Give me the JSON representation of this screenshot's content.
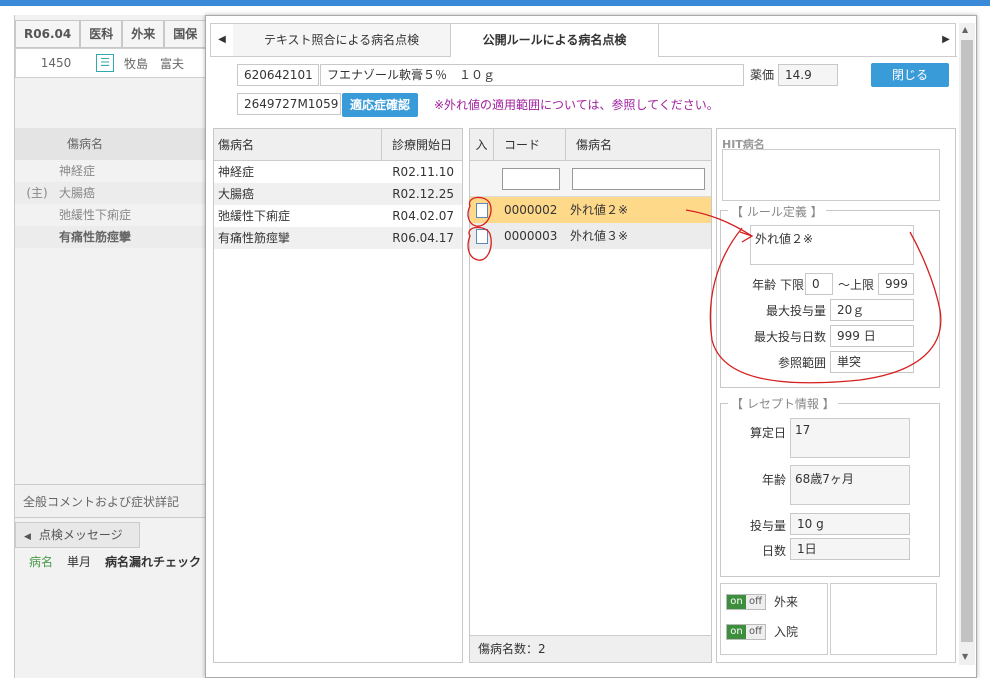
{
  "bg": {
    "row1": [
      "R06.04",
      "医科",
      "外来",
      "国保"
    ],
    "row2_number": "1450",
    "row2_name": "牧島　富夫",
    "list_header": "傷病名",
    "list": [
      {
        "prefix": "",
        "name": "神経症"
      },
      {
        "prefix": "(主)",
        "name": "大腸癌"
      },
      {
        "prefix": "",
        "name": "弛緩性下痢症"
      },
      {
        "prefix": "",
        "name": "有痛性筋痙攣"
      }
    ],
    "comment_label": "全般コメントおよび症状詳記",
    "msg_tab": "点検メッセージ",
    "msg_cols": [
      "病名",
      "単月",
      "病名漏れチェック"
    ]
  },
  "tabs": {
    "text_match": "テキスト照合による病名点検",
    "public_rule": "公開ルールによる病名点検"
  },
  "drug": {
    "code": "620642101",
    "name": "フエナゾール軟膏５％　１０ｇ",
    "price_label": "薬価",
    "price": "14.9",
    "close_label": "閉じる",
    "rec_code": "2649727M1059",
    "indication_button": "適応症確認",
    "note": "※外れ値の適用範囲については、参照してください。"
  },
  "disease_table": {
    "col_name": "傷病名",
    "col_date": "診療開始日",
    "rows": [
      {
        "name": "神経症",
        "date": "R02.11.10"
      },
      {
        "name": "大腸癌",
        "date": "R02.12.25"
      },
      {
        "name": "弛緩性下痢症",
        "date": "R04.02.07"
      },
      {
        "name": "有痛性筋痙攣",
        "date": "R06.04.17"
      }
    ]
  },
  "rule_table": {
    "col_in": "入",
    "col_code": "コード",
    "col_name": "傷病名",
    "rows": [
      {
        "code": "0000002",
        "name": "外れ値２※"
      },
      {
        "code": "0000003",
        "name": "外れ値３※"
      }
    ],
    "count_label": "傷病名数：2"
  },
  "hit": {
    "label": "HIT病名"
  },
  "rule_def": {
    "legend": "【 ルール定義 】",
    "name": "外れ値２※",
    "age_label": "年齢 下限",
    "age_min": "0",
    "age_max_label": "～上限",
    "age_max": "999",
    "max_dose_label": "最大投与量",
    "max_dose": "20ｇ",
    "max_days_label": "最大投与日数",
    "max_days": "999 日",
    "ref_label": "参照範囲",
    "ref": "単突"
  },
  "receipt": {
    "legend": "【 レセプト情報 】",
    "calc_day_label": "算定日",
    "calc_day": "17",
    "age_label": "年齢",
    "age": "68歳7ヶ月",
    "dose_label": "投与量",
    "dose": "10 g",
    "days_label": "日数",
    "days": "1日"
  },
  "toggles": [
    {
      "on": "on",
      "off": "off",
      "label": "外来"
    },
    {
      "on": "on",
      "off": "off",
      "label": "入院"
    }
  ],
  "colors": {
    "accent": "#3a9bd9",
    "highlight": "#ffd98a",
    "annotation": "#d62020",
    "note": "#a020a0"
  }
}
